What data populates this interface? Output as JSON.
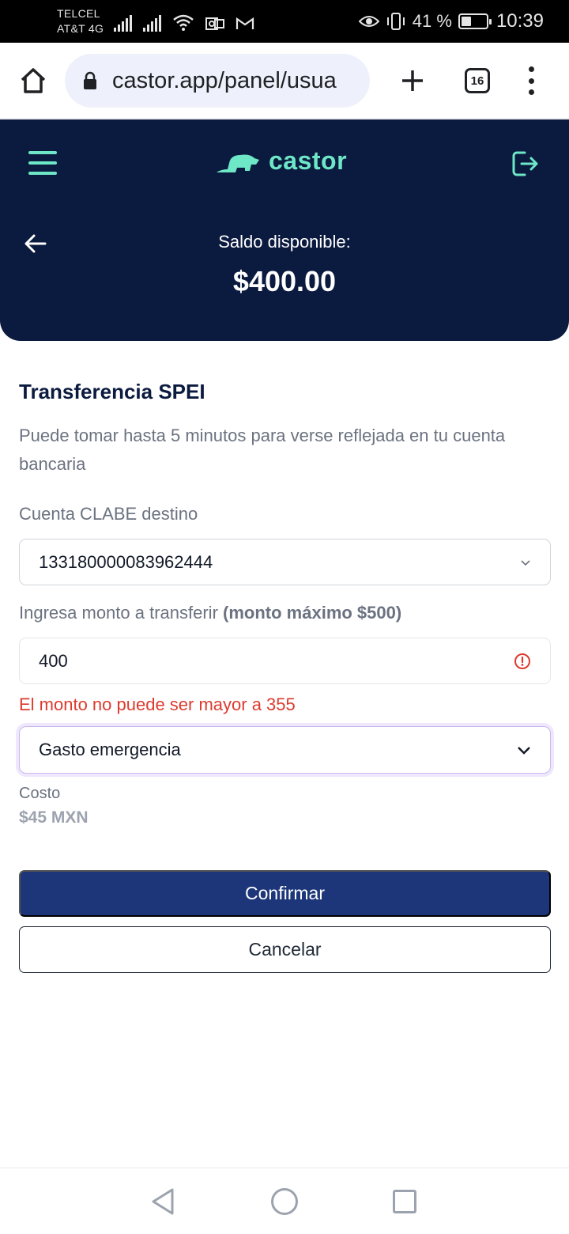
{
  "status_bar": {
    "carrier_1": "TELCEL",
    "carrier_2": "AT&T 4G",
    "battery_text": "41 %",
    "battery_level": 0.41,
    "time": "10:39"
  },
  "browser": {
    "url": "castor.app/panel/usua",
    "tab_count": "16"
  },
  "header": {
    "brand": "castor",
    "balance_label": "Saldo disponible:",
    "balance_value": "$400.00"
  },
  "form": {
    "title": "Transferencia SPEI",
    "subtitle": "Puede tomar hasta 5 minutos para verse reflejada en tu cuenta bancaria",
    "clabe_label": "Cuenta CLABE destino",
    "clabe_value": "133180000083962444",
    "amount_label": "Ingresa monto a transferir",
    "amount_label_bold": "(monto máximo $500)",
    "amount_value": "400",
    "amount_error": "El monto no puede ser mayor a 355",
    "concept_value": "Gasto emergencia",
    "cost_label": "Costo",
    "cost_value": "$45 MXN",
    "confirm_label": "Confirmar",
    "cancel_label": "Cancelar"
  },
  "icons": {
    "home": "home-icon",
    "lock": "lock-icon",
    "new_tab": "plus-icon",
    "tabs": "tabs-icon",
    "more": "more-vert-icon",
    "menu": "hamburger-icon",
    "logout": "logout-icon",
    "back": "arrow-left-icon",
    "error": "error-circle-icon",
    "chevron": "chevron-down-icon"
  },
  "colors": {
    "header_bg": "#0b1a3f",
    "accent": "#6ee7c7",
    "primary_button": "#1c3679",
    "error": "#dc3b2e"
  }
}
